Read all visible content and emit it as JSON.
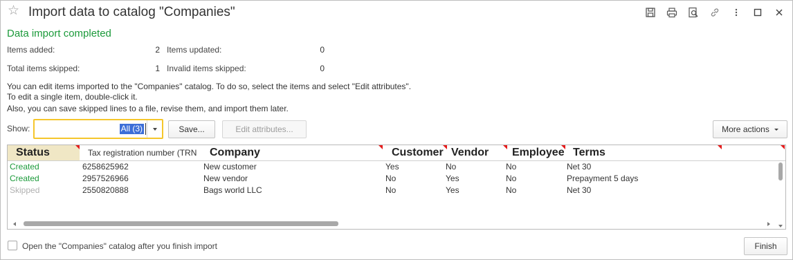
{
  "window": {
    "title": "Import data to catalog \"Companies\""
  },
  "summary": {
    "heading": "Data import completed",
    "items_added_label": "Items added:",
    "items_added": "2",
    "items_updated_label": "Items updated:",
    "items_updated": "0",
    "total_skipped_label": "Total items skipped:",
    "total_skipped": "1",
    "invalid_skipped_label": "Invalid items skipped:",
    "invalid_skipped": "0"
  },
  "info": {
    "line1": "You can edit items imported to the \"Companies\" catalog. To do so, select the items and select \"Edit attributes\".",
    "line2": "To edit a single item, double-click it.",
    "line3": "Also, you can save skipped lines to a file, revise them, and import them later."
  },
  "toolbar": {
    "show_label": "Show:",
    "show_value": "All (3)",
    "save_label": "Save...",
    "edit_attributes_label": "Edit attributes...",
    "more_actions_label": "More actions"
  },
  "table": {
    "columns": {
      "status": "Status",
      "tax": "Tax registration number (TRN",
      "company": "Company",
      "customer": "Customer",
      "vendor": "Vendor",
      "employee": "Employee",
      "terms": "Terms"
    },
    "rows": [
      {
        "status": "Created",
        "tax": "6258625962",
        "company": "New customer",
        "customer": "Yes",
        "vendor": "No",
        "employee": "No",
        "terms": "Net 30"
      },
      {
        "status": "Created",
        "tax": "2957526966",
        "company": "New vendor",
        "customer": "No",
        "vendor": "Yes",
        "employee": "No",
        "terms": "Prepayment 5 days"
      },
      {
        "status": "Skipped",
        "tax": "2550820888",
        "company": "Bags world LLC",
        "customer": "No",
        "vendor": "Yes",
        "employee": "No",
        "terms": "Net 30"
      }
    ]
  },
  "footer": {
    "open_catalog_label": "Open the \"Companies\" catalog after you finish import",
    "open_catalog_checked": false,
    "finish_label": "Finish"
  },
  "colors": {
    "created": "#1b9a3a",
    "skipped": "#b0b0b0",
    "focus_border": "#f5c62b",
    "selection": "#3d6fd8",
    "status_header": "#f0e7c5",
    "corner_mark": "#e51c1c"
  },
  "icons": [
    "star-icon",
    "save-icon",
    "print-icon",
    "preview-icon",
    "link-icon",
    "more-vertical-icon",
    "maximize-icon",
    "close-icon"
  ]
}
